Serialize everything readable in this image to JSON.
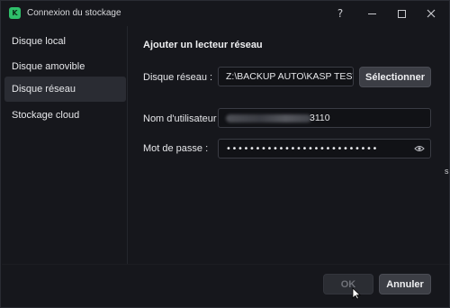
{
  "window": {
    "title": "Connexion du stockage",
    "help_label": "?"
  },
  "sidebar": {
    "items": [
      {
        "label": "Disque local"
      },
      {
        "label": "Disque amovible"
      },
      {
        "label": "Disque réseau",
        "active": true
      },
      {
        "label": "Stockage cloud"
      }
    ]
  },
  "main": {
    "section_title": "Ajouter un lecteur réseau",
    "network_drive_label": "Disque réseau :",
    "network_drive_value": "Z:\\BACKUP AUTO\\KASP TEST",
    "select_button": "Sélectionner",
    "username_label": "Nom d'utilisateur :",
    "username_visible_suffix": "3110",
    "password_label": "Mot de passe :",
    "password_mask": "••••••••••••••••••••••••••"
  },
  "footer": {
    "ok_label": "OK",
    "cancel_label": "Annuler"
  },
  "colors": {
    "background": "#16171c",
    "accent_app_icon": "#2fbf6a",
    "button": "#3c3e45",
    "selected_item": "#2a2c33"
  },
  "icons": [
    "app-logo-icon",
    "help-icon",
    "minimize-icon",
    "maximize-icon",
    "close-icon",
    "eye-icon",
    "mouse-cursor-icon"
  ]
}
